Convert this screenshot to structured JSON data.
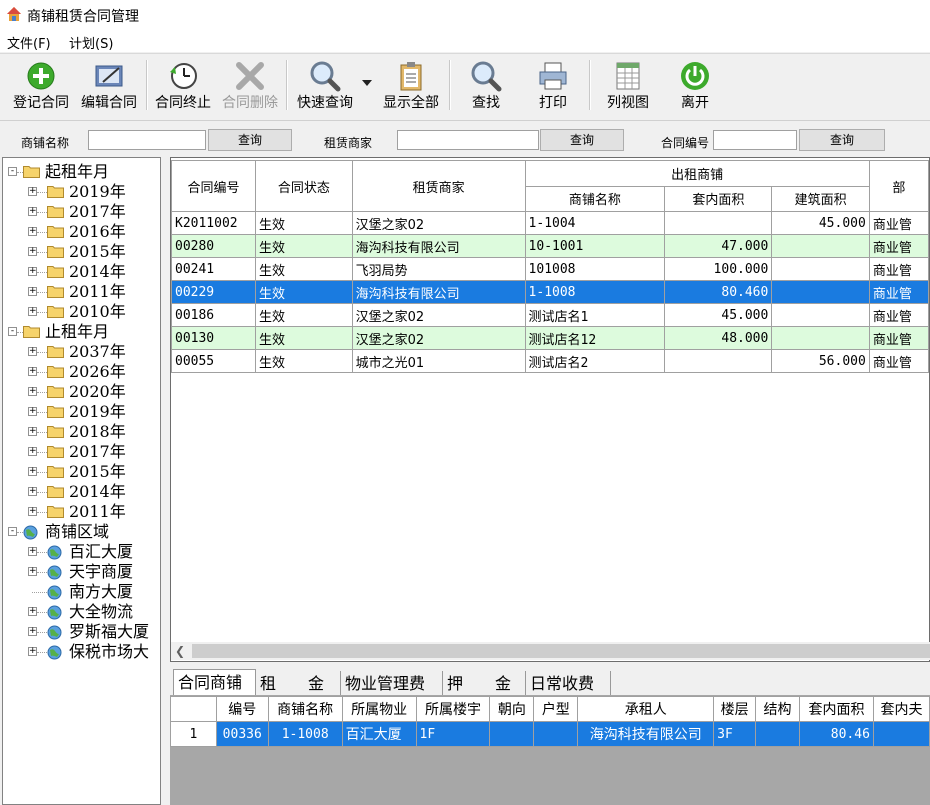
{
  "window": {
    "title": "商铺租赁合同管理"
  },
  "menu": {
    "file": "文件(F)",
    "plan": "计划(S)"
  },
  "toolbar": {
    "register": "登记合同",
    "edit": "编辑合同",
    "terminate": "合同终止",
    "delete": "合同删除",
    "quick_query": "快速查询",
    "show_all": "显示全部",
    "find": "查找",
    "print": "打印",
    "list_view": "列视图",
    "exit": "离开"
  },
  "search": {
    "shop_name_label": "商铺名称",
    "shop_name_value": "",
    "query1": "查询",
    "tenant_label": "租赁商家",
    "tenant_value": "",
    "query2": "查询",
    "contract_no_label": "合同编号",
    "contract_no_value": "",
    "query3": "查询"
  },
  "tree": {
    "start_root": "起租年月",
    "start_years": [
      "2019年",
      "2017年",
      "2016年",
      "2015年",
      "2014年",
      "2011年",
      "2010年"
    ],
    "end_root": "止租年月",
    "end_years": [
      "2037年",
      "2026年",
      "2020年",
      "2019年",
      "2018年",
      "2017年",
      "2015年",
      "2014年",
      "2011年"
    ],
    "area_root": "商铺区域",
    "areas": [
      "百汇大厦",
      "天宇商厦",
      "南方大厦",
      "大全物流",
      "罗斯福大厦",
      "保税市场大"
    ]
  },
  "grid": {
    "headers": {
      "contract_no": "合同编号",
      "status": "合同状态",
      "tenant": "租赁商家",
      "shop_group": "出租商铺",
      "shop_name": "商铺名称",
      "inner_area": "套内面积",
      "build_area": "建筑面积",
      "dept": "部"
    },
    "rows": [
      {
        "no": "K2011002",
        "status": "生效",
        "tenant": "汉堡之家02",
        "shop": "1-1004",
        "inner": "",
        "build": "45.000",
        "dept": "商业管"
      },
      {
        "no": "00280",
        "status": "生效",
        "tenant": "海沟科技有限公司",
        "shop": "10-1001",
        "inner": "47.000",
        "build": "",
        "dept": "商业管"
      },
      {
        "no": "00241",
        "status": "生效",
        "tenant": "飞羽局势",
        "shop": "101008",
        "inner": "100.000",
        "build": "",
        "dept": "商业管"
      },
      {
        "no": "00229",
        "status": "生效",
        "tenant": "海沟科技有限公司",
        "shop": "1-1008",
        "inner": "80.460",
        "build": "",
        "dept": "商业管"
      },
      {
        "no": "00186",
        "status": "生效",
        "tenant": "汉堡之家02",
        "shop": "测试店名1",
        "inner": "45.000",
        "build": "",
        "dept": "商业管"
      },
      {
        "no": "00130",
        "status": "生效",
        "tenant": "汉堡之家02",
        "shop": "测试店名12",
        "inner": "48.000",
        "build": "",
        "dept": "商业管"
      },
      {
        "no": "00055",
        "status": "生效",
        "tenant": "城市之光01",
        "shop": "测试店名2",
        "inner": "",
        "build": "56.000",
        "dept": "商业管"
      }
    ]
  },
  "tabs": [
    "合同商铺",
    "租　　金",
    "物业管理费",
    "押　　金",
    "日常收费"
  ],
  "subgrid": {
    "headers": [
      "编号",
      "商铺名称",
      "所属物业",
      "所属楼宇",
      "朝向",
      "户型",
      "承租人",
      "楼层",
      "结构",
      "套内面积",
      "套内夫"
    ],
    "row": {
      "index": "1",
      "no": "00336",
      "shop": "1-1008",
      "property": "百汇大厦",
      "building": "1F",
      "facing": "",
      "type": "",
      "tenant": "海沟科技有限公司",
      "floor": "3F",
      "structure": "",
      "inner": "80.46",
      "extra": ""
    }
  },
  "colors": {
    "selection": "#1a7be0",
    "green_row": "#ddfbdd"
  }
}
